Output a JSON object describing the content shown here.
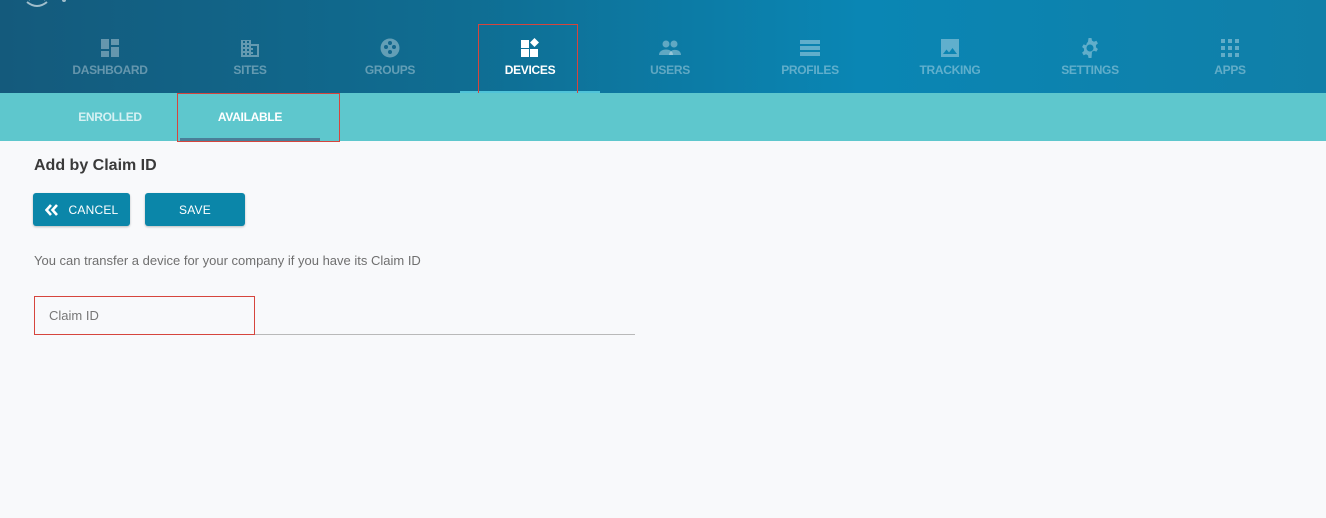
{
  "nav": {
    "items": [
      {
        "label": "DASHBOARD",
        "icon": "dashboard-icon"
      },
      {
        "label": "SITES",
        "icon": "building-icon"
      },
      {
        "label": "GROUPS",
        "icon": "groups-icon"
      },
      {
        "label": "DEVICES",
        "icon": "devices-icon",
        "active": true
      },
      {
        "label": "USERS",
        "icon": "users-icon"
      },
      {
        "label": "PROFILES",
        "icon": "list-icon"
      },
      {
        "label": "TRACKING",
        "icon": "image-icon"
      },
      {
        "label": "SETTINGS",
        "icon": "gear-icon"
      },
      {
        "label": "APPS",
        "icon": "apps-grid-icon"
      }
    ]
  },
  "subnav": {
    "tabs": [
      {
        "label": "ENROLLED"
      },
      {
        "label": "AVAILABLE",
        "active": true
      }
    ]
  },
  "main": {
    "title": "Add by Claim ID",
    "cancel_label": "CANCEL",
    "save_label": "SAVE",
    "helper_text": "You can transfer a device for your company if you have its Claim ID",
    "claim_field": {
      "placeholder": "Claim ID",
      "value": ""
    }
  },
  "colors": {
    "nav_gradient_start": "#145a7c",
    "nav_gradient_end": "#0a86b4",
    "subnav_bg": "#5ec7cd",
    "button_bg": "#0b86a9",
    "highlight_border": "#d6453d"
  }
}
